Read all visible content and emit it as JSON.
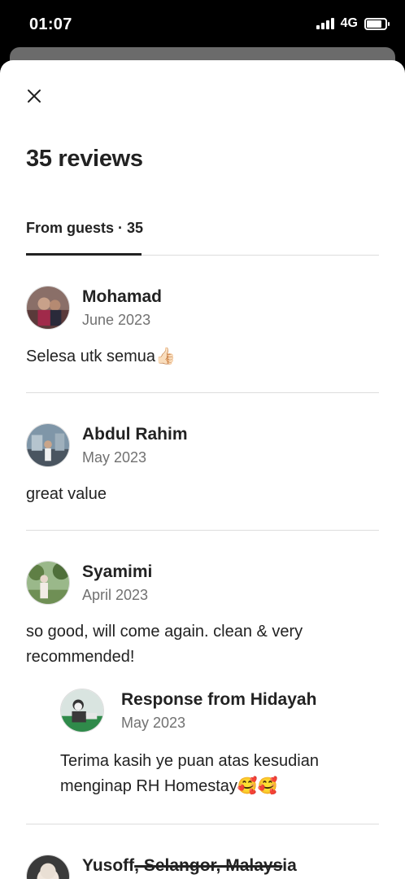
{
  "status_bar": {
    "time": "01:07",
    "network": "4G"
  },
  "modal": {
    "title": "35 reviews",
    "close_icon": "close-icon",
    "tabs": [
      {
        "label": "From guests · 35",
        "active": true
      }
    ]
  },
  "reviews": [
    {
      "name": "Mohamad",
      "date": "June 2023",
      "text": "Selesa utk semua👍🏻"
    },
    {
      "name": "Abdul Rahim",
      "date": "May 2023",
      "text": "great value"
    },
    {
      "name": "Syamimi",
      "date": "April 2023",
      "text": "so good, will come again. clean & very recommended!",
      "response": {
        "title": "Response from Hidayah",
        "date": "May 2023",
        "text": "Terima kasih ye puan atas kesudian menginap RH Homestay🥰🥰"
      }
    },
    {
      "name_prefix": "Yusoff",
      "name_struck": ", Selangor, Malays",
      "name_suffix": "ia"
    }
  ],
  "colors": {
    "text": "#222222",
    "secondary": "#717171",
    "divider": "#dddddd"
  }
}
